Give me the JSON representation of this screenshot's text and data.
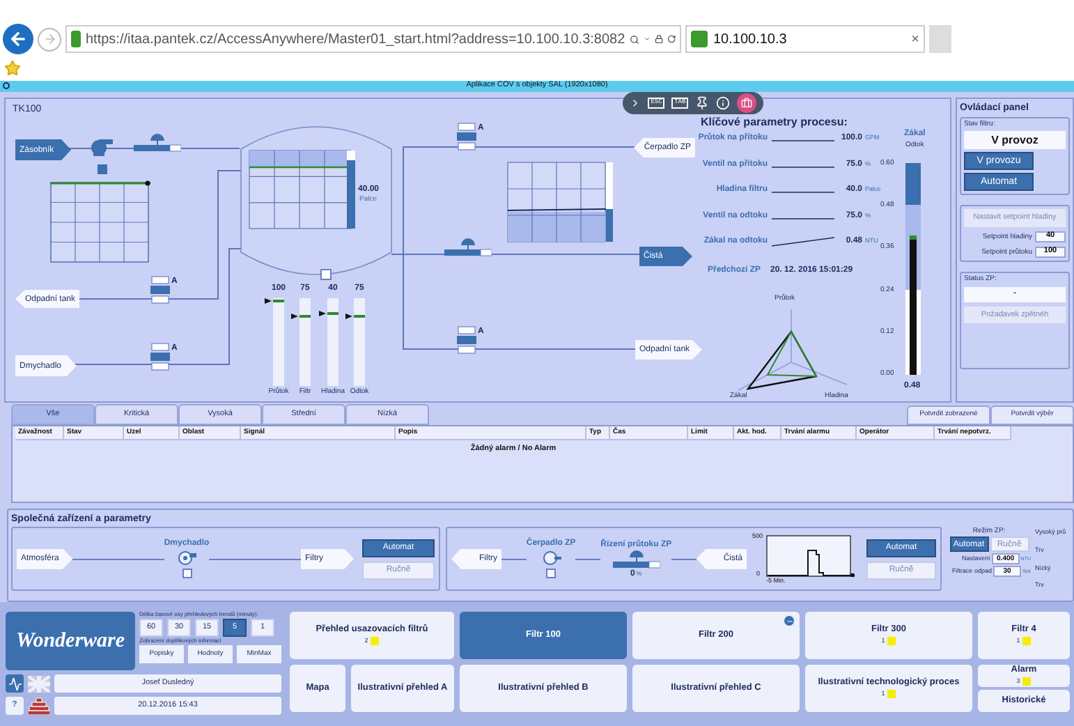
{
  "browser": {
    "url": "https://itaa.pantek.cz/AccessAnywhere/Master01_start.html?address=10.100.10.3:8082",
    "tab_title": "10.100.10.3",
    "tab_close": "×"
  },
  "app_title": "Aplikace COV s objekty SAL (1920x1080)",
  "toolbar": {
    "keys": [
      "ESC",
      "TAB"
    ]
  },
  "tk100": {
    "title": "TK100",
    "arrows": [
      {
        "label": "Zásobník",
        "kind": "right",
        "highlighted": true
      },
      {
        "label": "Odpadní tank",
        "kind": "left",
        "highlighted": false
      },
      {
        "label": "Dmychadlo",
        "kind": "right",
        "highlighted": false
      },
      {
        "label": "Čerpadlo ZP",
        "kind": "left",
        "highlighted": false
      },
      {
        "label": "Čistá",
        "kind": "right",
        "highlighted": true
      },
      {
        "label": "Odpadní tank",
        "kind": "right",
        "highlighted": false
      }
    ],
    "valve_modes": [
      "A",
      "A",
      "A",
      "A"
    ],
    "tank_reading": {
      "value": "40.00",
      "unit": "Palce"
    },
    "bars": [
      {
        "label": "Průtok",
        "value": "100",
        "level": 0.97
      },
      {
        "label": "Filtr",
        "value": "75",
        "level": 0.8
      },
      {
        "label": "Hladina",
        "value": "40",
        "level": 0.83
      },
      {
        "label": "Odtok",
        "value": "75",
        "level": 0.8
      }
    ],
    "key_params": {
      "title": "Klíčové parametry procesu:",
      "rows": [
        {
          "label": "Průtok na přítoku",
          "value": "100.0",
          "unit": "GPM"
        },
        {
          "label": "Ventil na přítoku",
          "value": "75.0",
          "unit": "%"
        },
        {
          "label": "Hladina filtru",
          "value": "40.0",
          "unit": "Palce"
        },
        {
          "label": "Ventil na odtoku",
          "value": "75.0",
          "unit": "%"
        },
        {
          "label": "Zákal na odtoku",
          "value": "0.48",
          "unit": "NTU"
        }
      ],
      "previous_label": "Předchozí ZP",
      "previous_value": "20. 12. 2016 15:01:29"
    },
    "radar_labels": [
      "Průtok",
      "Zákal",
      "Hladina"
    ],
    "turbidity": {
      "title": "Zákal",
      "subtitle": "Odtok",
      "ticks": [
        "0.60",
        "0.48",
        "0.36",
        "0.24",
        "0.12",
        "0.00"
      ],
      "reading": "0.48",
      "level": 0.66
    }
  },
  "control_panel": {
    "title": "Ovládací panel",
    "state_label": "Stav filtru:",
    "state_value": "V provoz",
    "state_buttons": [
      {
        "label": "V provozu",
        "selected": true
      },
      {
        "label": "Automat",
        "selected": true
      }
    ],
    "setpoint_button": "Nastavit setpoint hladiny",
    "setpoints": [
      {
        "label": "Setpoint hladiny",
        "value": "40"
      },
      {
        "label": "Setpoint průtoku",
        "value": "100"
      }
    ],
    "status_label": "Status ZP:",
    "status_value": "-",
    "request_button": "Požadavek zpětnéh"
  },
  "alarms": {
    "tabs": [
      {
        "label": "Vše",
        "selected": true
      },
      {
        "label": "Kritická",
        "selected": false
      },
      {
        "label": "Vysoká",
        "selected": false
      },
      {
        "label": "Střední",
        "selected": false
      },
      {
        "label": "Nízká",
        "selected": false
      }
    ],
    "actions": [
      "Potvrdit zobrazené",
      "Potvrdit výběr"
    ],
    "columns": [
      "Závažnost",
      "Stav",
      "Uzel",
      "Oblast",
      "Signál",
      "Popis",
      "Typ",
      "Čas",
      "Limit",
      "Akt. hod.",
      "Trvání alarmu",
      "Operátor",
      "Trvání nepotvrz."
    ],
    "empty": "Žádný alarm / No Alarm"
  },
  "common": {
    "title": "Společná zařízení a parametry",
    "blower": {
      "source": {
        "label": "Atmosféra",
        "kind": "right",
        "highlighted": false
      },
      "device": "Dmychadlo",
      "checked": false,
      "target": {
        "label": "Filtry",
        "kind": "right",
        "highlighted": false
      },
      "modes": [
        {
          "label": "Automat",
          "selected": true
        },
        {
          "label": "Ručně",
          "selected": false
        }
      ]
    },
    "pump": {
      "target": {
        "label": "Filtry",
        "kind": "left",
        "highlighted": false
      },
      "device": "Čerpadlo ZP",
      "checked": false,
      "control": "Řízení průtoku ZP",
      "control_value": "0",
      "control_unit": "%",
      "source": {
        "label": "Čistá",
        "kind": "left",
        "highlighted": false
      },
      "trend_ticks": [
        "500",
        "0"
      ],
      "trend_xlabel": "-5 Min.",
      "modes": [
        {
          "label": "Automat",
          "selected": true
        },
        {
          "label": "Ručně",
          "selected": false
        }
      ]
    },
    "mode": {
      "title": "Režim ZP:",
      "modes": [
        {
          "label": "Automat",
          "selected": true
        },
        {
          "label": "Ručně",
          "selected": false
        }
      ],
      "settings": [
        {
          "label": "Nastavení",
          "value": "0.400",
          "unit": "NTU"
        },
        {
          "label": "Filtrace odpad",
          "value": "30",
          "unit": "Sek"
        }
      ]
    },
    "cut_labels": [
      "Vysoký prů",
      "Trv",
      "Nízký",
      "Trv"
    ]
  },
  "footer": {
    "logo": "Wonderware",
    "trend_label": "Délka časové osy přehledových trendů (minuty):",
    "ranges": [
      {
        "label": "60",
        "selected": false
      },
      {
        "label": "30",
        "selected": false
      },
      {
        "label": "15",
        "selected": false
      },
      {
        "label": "5",
        "selected": true
      },
      {
        "label": "1",
        "selected": false
      }
    ],
    "info_label": "Zobrazení doplňkových informací",
    "info_buttons": [
      "Popisky",
      "Hodnoty",
      "MinMax"
    ],
    "user": "Josef Dusledný",
    "datetime": "20.12.2016 15:43",
    "help": "?",
    "tiles_top": [
      {
        "label": "Přehled usazovacích filtrů",
        "count": "2",
        "selected": false,
        "badge": false
      },
      {
        "label": "Filtr 100",
        "selected": true,
        "badge": false
      },
      {
        "label": "Filtr 200",
        "selected": false,
        "badge": true
      },
      {
        "label": "Filtr 300",
        "count": "1",
        "selected": false,
        "badge": false
      },
      {
        "label": "Filtr 4",
        "count": "1",
        "selected": false,
        "badge": false
      }
    ],
    "tiles_bottom": [
      {
        "kind": "tile",
        "label": "Mapa",
        "selected": false
      },
      {
        "kind": "tile",
        "label": "Ilustrativní přehled A",
        "selected": false
      },
      {
        "kind": "tile",
        "label": "Ilustrativní přehled B",
        "selected": false
      },
      {
        "kind": "tile",
        "label": "Ilustrativní přehled C",
        "selected": false
      },
      {
        "kind": "tile",
        "label": "Ilustrativní technologický proces",
        "count": "1",
        "selected": false
      },
      {
        "kind": "stack",
        "items": [
          {
            "label": "Alarm",
            "count": "3",
            "selected": false
          },
          {
            "label": "Historické",
            "selected": false
          }
        ]
      }
    ]
  }
}
